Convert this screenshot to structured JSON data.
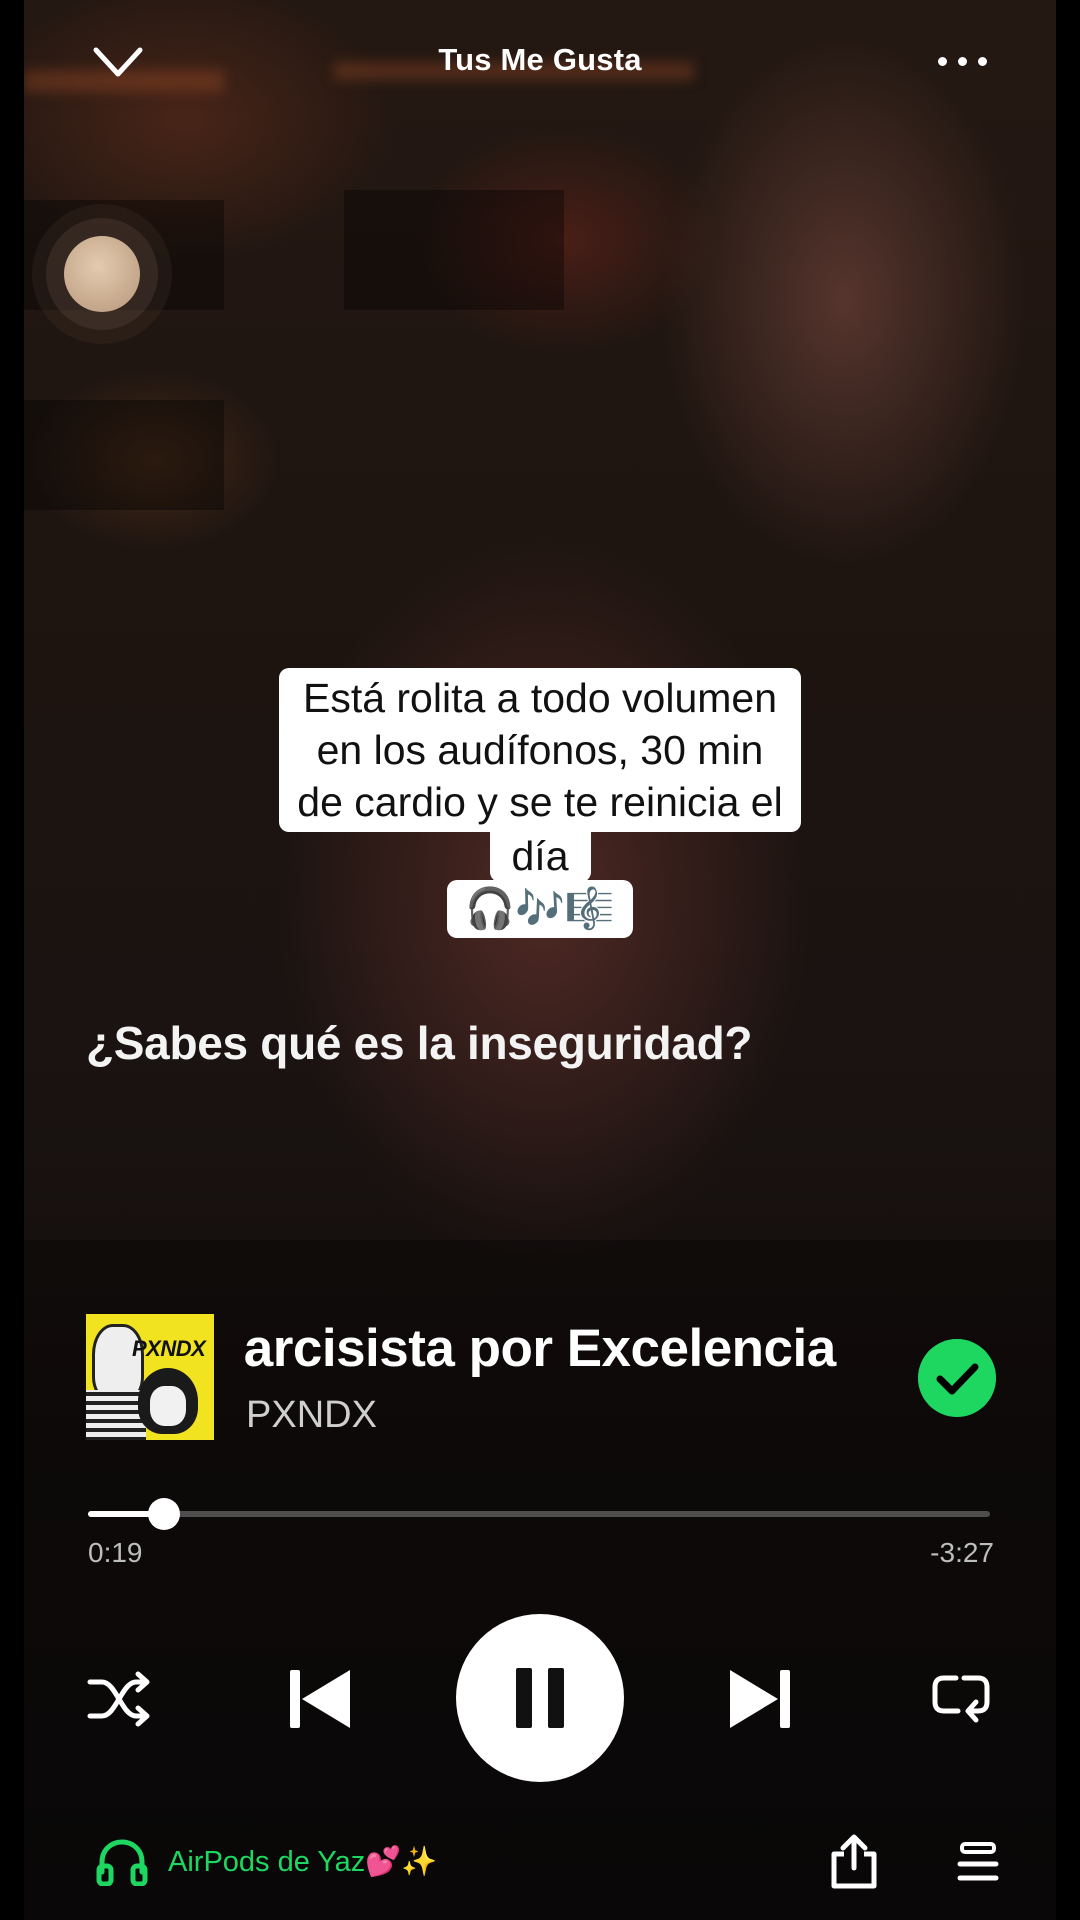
{
  "header": {
    "collapse_icon": "chevron-down-icon",
    "title": "Tus Me Gusta",
    "more_icon": "more-horizontal-icon"
  },
  "caption": {
    "line1": "Está rolita a todo volumen",
    "line2": "en los audífonos, 30 min",
    "line3": "de cardio y se te reinicia el",
    "line4": "día",
    "emoji": "🎧🎶🎼"
  },
  "lyric": "¿Sabes qué es la inseguridad?",
  "now_playing": {
    "cover_text": "PXNDX",
    "title": "Narcisista por Excelencia",
    "artist": "PXNDX",
    "saved_icon": "check-circle-icon"
  },
  "progress": {
    "elapsed": "0:19",
    "remaining": "-3:27",
    "fraction": 0.084
  },
  "controls": {
    "shuffle_icon": "shuffle-icon",
    "previous_icon": "skip-previous-icon",
    "pause_icon": "pause-icon",
    "next_icon": "skip-next-icon",
    "repeat_icon": "repeat-icon"
  },
  "footer": {
    "device_icon": "headphones-icon",
    "device_name": "AirPods de Yaz💕✨",
    "share_icon": "share-icon",
    "queue_icon": "queue-icon"
  },
  "colors": {
    "accent": "#1ed760",
    "cover": "#f2e321"
  }
}
